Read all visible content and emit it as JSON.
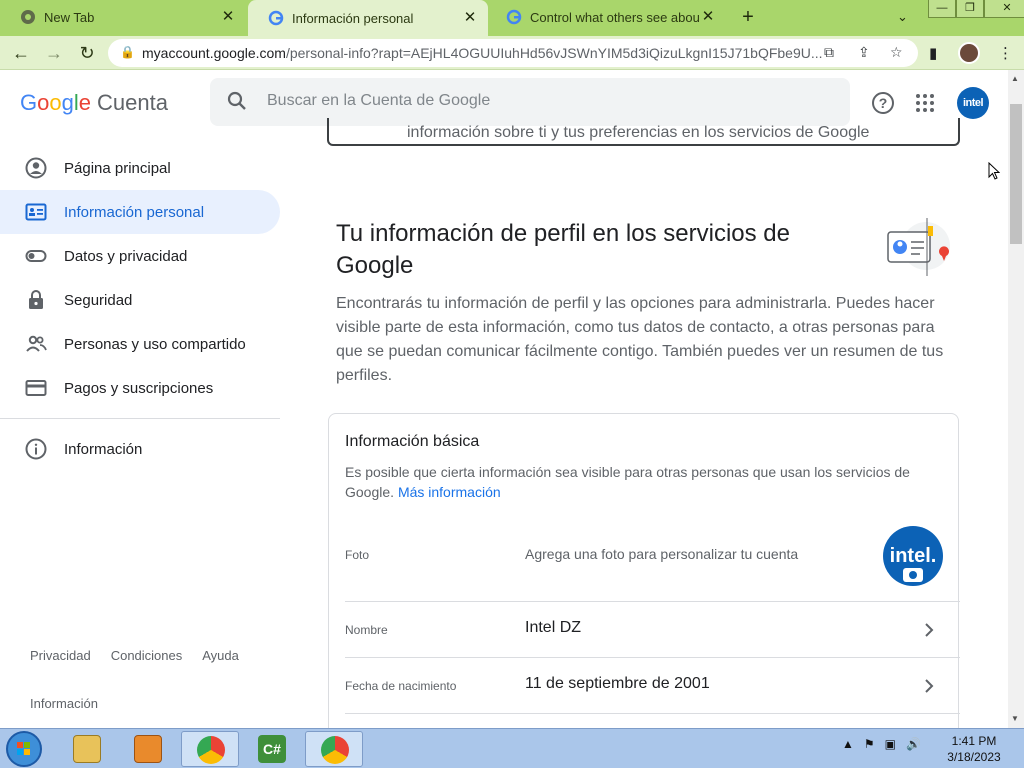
{
  "browser": {
    "tabs": [
      {
        "title": "New Tab",
        "active": false
      },
      {
        "title": "Información personal",
        "active": true
      },
      {
        "title": "Control what others see about yo",
        "active": false
      }
    ],
    "newtab_label": "+",
    "tabs_menu": "⌄",
    "window_buttons": {
      "minimize": "—",
      "restore": "❐",
      "close": "✕"
    },
    "url_host": "myaccount.google.com",
    "url_rest": "/personal-info?rapt=AEjHL4OGUUIuhHd56vJSWnYIM5d3iQizuLkgnI15J71bQFbe9U..."
  },
  "header": {
    "logo": {
      "g1": "G",
      "g2": "o",
      "g3": "o",
      "g4": "g",
      "g5": "l",
      "g6": "e",
      "product": "Cuenta"
    },
    "search_placeholder": "Buscar en la Cuenta de Google",
    "help_label": "?",
    "avatar_text": "intel"
  },
  "sidebar": {
    "items": [
      {
        "label": "Página principal",
        "icon": "account-circle-icon"
      },
      {
        "label": "Información personal",
        "icon": "id-card-icon",
        "active": true
      },
      {
        "label": "Datos y privacidad",
        "icon": "toggle-icon"
      },
      {
        "label": "Seguridad",
        "icon": "lock-icon"
      },
      {
        "label": "Personas y uso compartido",
        "icon": "people-icon"
      },
      {
        "label": "Pagos y suscripciones",
        "icon": "credit-card-icon"
      }
    ],
    "info_item": {
      "label": "Información",
      "icon": "info-icon"
    },
    "footer": {
      "privacy": "Privacidad",
      "terms": "Condiciones",
      "help": "Ayuda",
      "info": "Información"
    }
  },
  "main": {
    "top_card_text": "información sobre ti y tus preferencias en los servicios de Google",
    "section_title": "Tu información de perfil en los servicios de Google",
    "section_desc": "Encontrarás tu información de perfil y las opciones para administrarla. Puedes hacer visible parte de esta información, como tus datos de contacto, a otras personas para que se puedan comunicar fácilmente contigo. También puedes ver un resumen de tus perfiles.",
    "basic_card": {
      "title": "Información básica",
      "desc": "Es posible que cierta información sea visible para otras personas que usan los servicios de Google.",
      "link": "Más información",
      "photo": {
        "label": "Foto",
        "value": "Agrega una foto para personalizar tu cuenta",
        "avatar_text": "intel."
      },
      "name": {
        "label": "Nombre",
        "value": "Intel DZ"
      },
      "birthday": {
        "label": "Fecha de nacimiento",
        "value": "11 de septiembre de 2001"
      }
    }
  },
  "taskbar": {
    "clock_time": "1:41 PM",
    "clock_date": "3/18/2023",
    "apps": [
      "windows-explorer",
      "media-player",
      "chrome",
      "csharp-ide",
      "chrome-profile"
    ]
  },
  "colors": {
    "accent": "#1a73e8",
    "active_nav_bg": "#e8f0fe",
    "active_nav_text": "#1967d2",
    "tabstrip": "#a9d66b"
  }
}
